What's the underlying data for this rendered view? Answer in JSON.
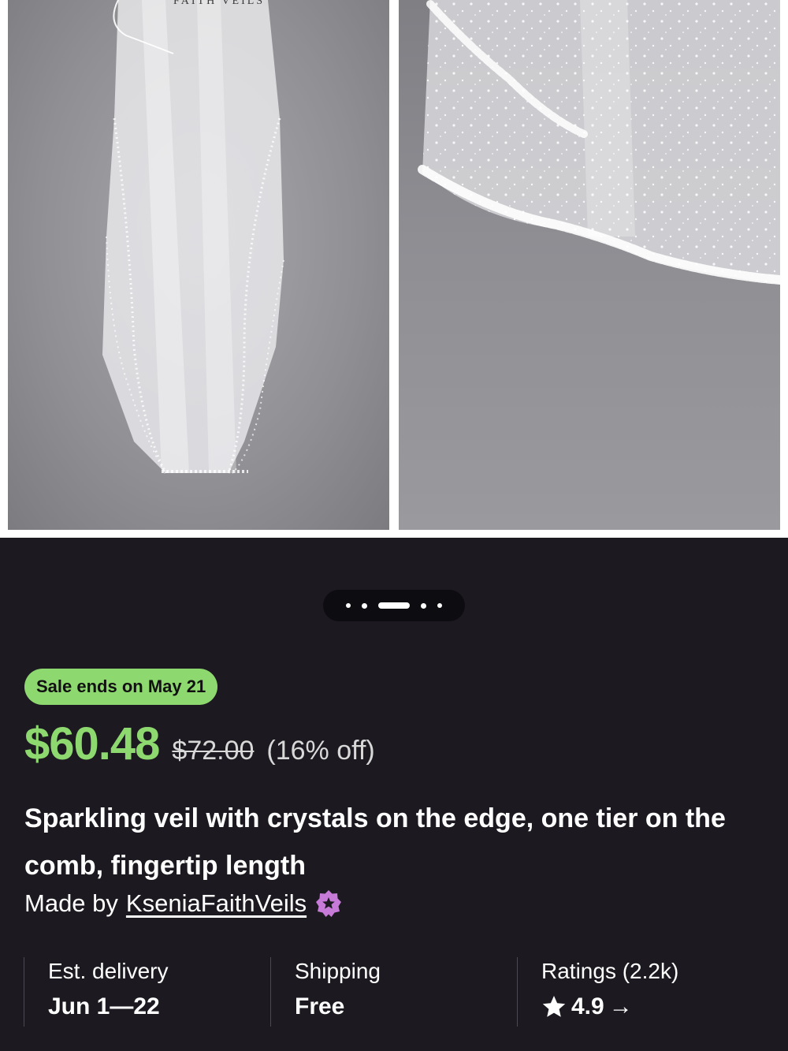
{
  "gallery": {
    "brand_watermark": "FAITH VEILS",
    "image_count": 5,
    "active_index": 2
  },
  "listing": {
    "sale_badge": "Sale ends on May 21",
    "price": "$60.48",
    "original_price": "$72.00",
    "discount": "(16% off)",
    "title": "Sparkling veil with crystals on the edge, one tier on the comb,  fingertip length",
    "made_by_prefix": "Made by",
    "shop_name": "KseniaFaithVeils"
  },
  "info": {
    "delivery_label": "Est. delivery",
    "delivery_value": "Jun 1—22",
    "shipping_label": "Shipping",
    "shipping_value": "Free",
    "ratings_label": "Ratings (2.2k)",
    "ratings_value": "4.9",
    "arrow": "→"
  },
  "colors": {
    "background": "#1c1a20",
    "sale_green": "#8ed96f",
    "star_seller_purple": "#c77ad8"
  },
  "icons": {
    "star": "star-icon",
    "arrow": "arrow-right-icon",
    "star_seller": "star-seller-badge-icon"
  }
}
